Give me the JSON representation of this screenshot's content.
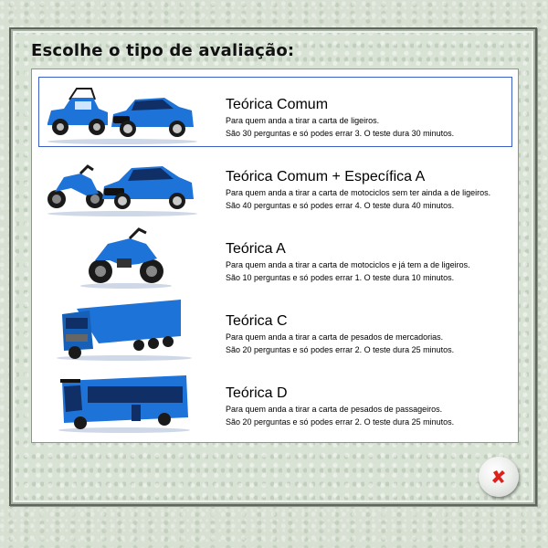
{
  "dialog": {
    "title": "Escolhe o tipo de avaliação:"
  },
  "options": [
    {
      "title": "Teórica Comum",
      "line1": "Para quem anda a tirar a carta de ligeiros.",
      "line2": "São 30 perguntas e só podes errar 3. O teste dura 30 minutos.",
      "icon": "buggy-and-car-icon",
      "selected": true
    },
    {
      "title": "Teórica Comum + Específica A",
      "line1": "Para quem anda a tirar a carta de motociclos sem ter ainda a de ligeiros.",
      "line2": "São 40 perguntas e só podes errar 4. O teste dura 40 minutos.",
      "icon": "motorcycle-and-car-icon"
    },
    {
      "title": "Teórica A",
      "line1": "Para quem anda a tirar a carta de motociclos e já tem a de ligeiros.",
      "line2": "São 10 perguntas e só podes errar 1. O teste dura 10 minutos.",
      "icon": "motorcycle-icon"
    },
    {
      "title": "Teórica C",
      "line1": "Para quem anda a tirar a carta de pesados de mercadorias.",
      "line2": "São 20 perguntas e só podes errar 2. O teste dura 25 minutos.",
      "icon": "truck-icon"
    },
    {
      "title": "Teórica D",
      "line1": "Para quem anda a tirar a carta de pesados de passageiros.",
      "line2": "São 20 perguntas e só podes errar 2. O teste dura 25 minutos.",
      "icon": "bus-icon"
    }
  ],
  "colors": {
    "vehicle_blue": "#1e73d8",
    "selection_border": "#3b5fc4",
    "close_red": "#e0201b"
  }
}
